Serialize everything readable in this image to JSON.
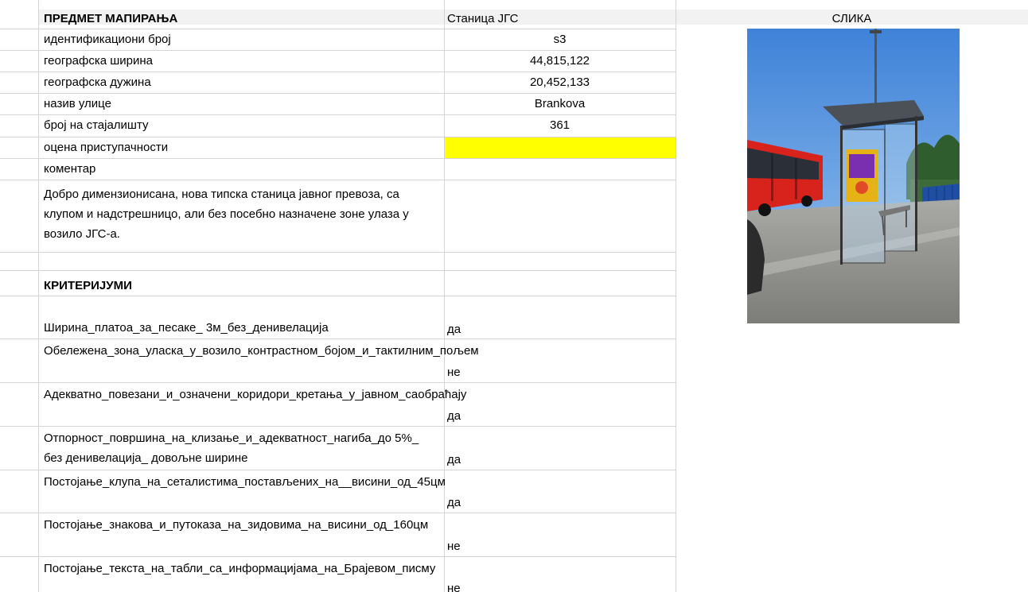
{
  "header": {
    "title": "ПРЕДМЕТ МАПИРАЊА",
    "station_type": "Станица ЈГС",
    "image_header": "СЛИКА"
  },
  "fields": [
    {
      "label": "идентификациони број",
      "value": "s3"
    },
    {
      "label": "географска ширина",
      "value": "44,815,122"
    },
    {
      "label": "географска дужина",
      "value": "20,452,133"
    },
    {
      "label": "назив улице",
      "value": "Brankova"
    },
    {
      "label": "број на стајалишту",
      "value": "361"
    },
    {
      "label": "оцена приступачности",
      "value": ""
    },
    {
      "label": "коментар",
      "value": ""
    }
  ],
  "comment_text": "Добро димензионисана, нова типска станица јавног превоза, са клупом и надстрешницо, али без посебно назначене зоне улаза у возило ЈГС-а.",
  "criteria_title": "КРИТЕРИЈУМИ",
  "criteria": [
    {
      "label": "Ширина_платоа_за_песаке_ 3м_без_денивелација",
      "value": "да"
    },
    {
      "label": "Обележена_зона_уласка_у_возило_контрастном_бојом_и_тактилним_пољем",
      "value": "не"
    },
    {
      "label": "Адекватно_повезани_и_означени_коридори_кретања_у_јавном_саобраћају",
      "value": "да"
    },
    {
      "label": "Отпорност_површина_на_клизање_и_адекватност_нагиба_до 5%_ без денивелација_ довољне ширине",
      "value": "да"
    },
    {
      "label": "Постојање_клупа_на_сеталистима_постављених_на__висини_од_45цм",
      "value": "да"
    },
    {
      "label": "Постојање_знакова_и_путоказа_на_зидовима_на_висини_од_160цм",
      "value": "не"
    },
    {
      "label": "Постојање_текста_на_табли_са_информацијама_на_Брајевом_писму",
      "value": "не"
    }
  ],
  "colors": {
    "accessibility_rating_fill": "#ffff00",
    "header_band": "#f2f2f2",
    "gridline": "#d4d4d4"
  }
}
